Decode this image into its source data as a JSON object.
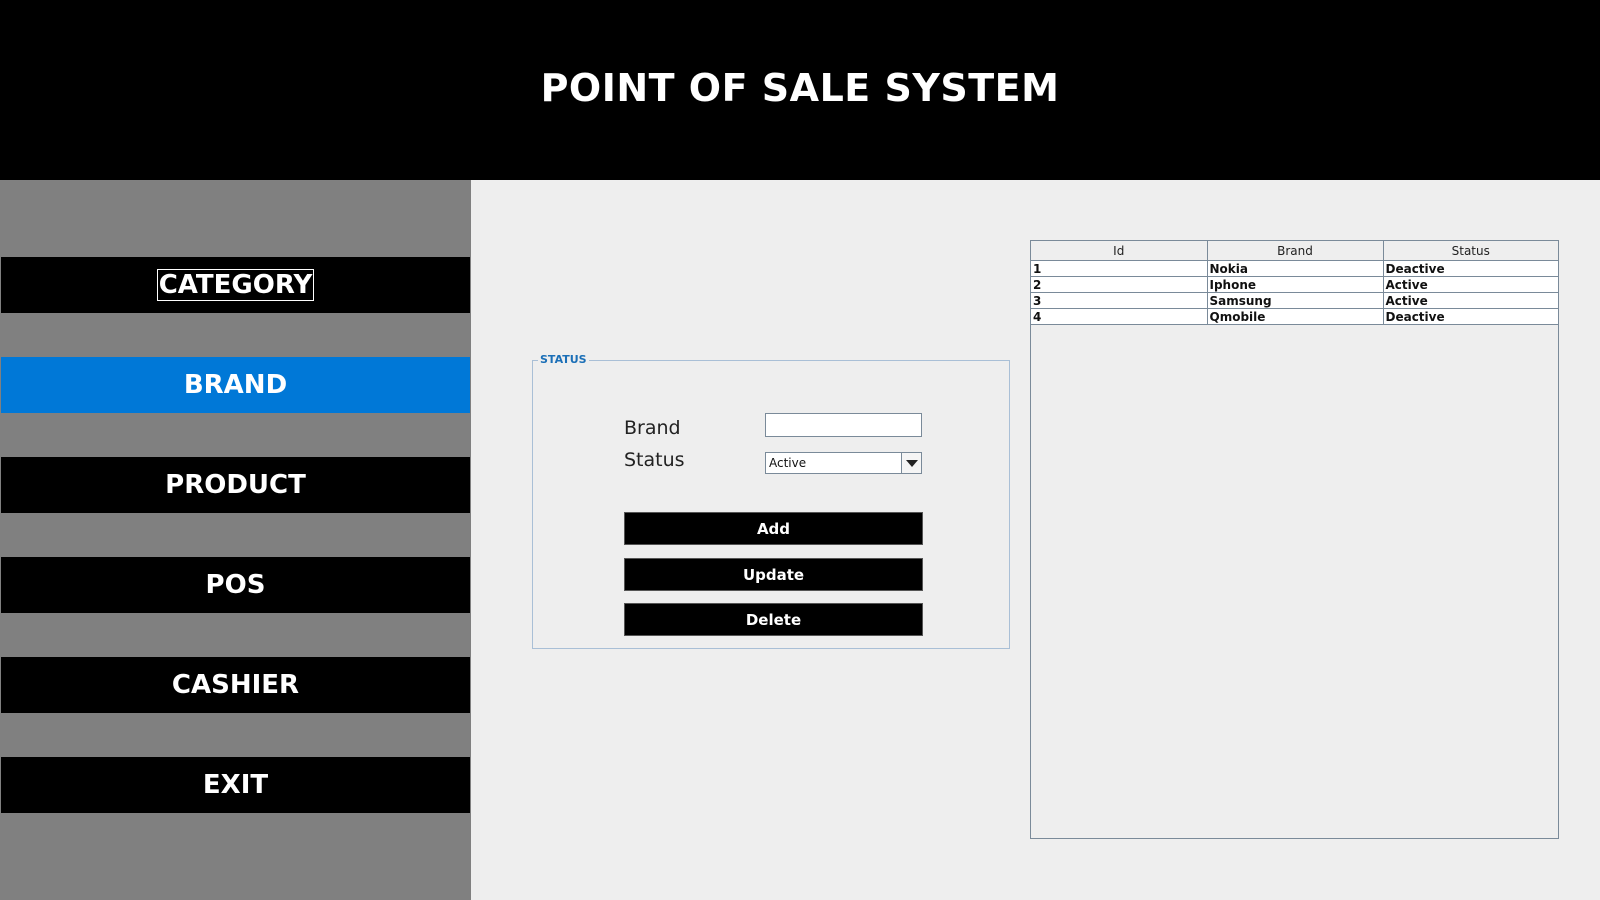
{
  "header": {
    "title": "POINT OF SALE SYSTEM"
  },
  "sidebar": {
    "items": [
      {
        "label": "CATEGORY",
        "active": false,
        "focused": true
      },
      {
        "label": "BRAND",
        "active": true,
        "focused": false
      },
      {
        "label": "PRODUCT",
        "active": false,
        "focused": false
      },
      {
        "label": "POS",
        "active": false,
        "focused": false
      },
      {
        "label": "CASHIER",
        "active": false,
        "focused": false
      },
      {
        "label": "EXIT",
        "active": false,
        "focused": false
      }
    ]
  },
  "form": {
    "group_title": "STATUS",
    "brand_label": "Brand",
    "brand_value": "",
    "status_label": "Status",
    "status_value": "Active",
    "buttons": {
      "add": "Add",
      "update": "Update",
      "delete": "Delete"
    }
  },
  "table": {
    "columns": [
      "Id",
      "Brand",
      "Status"
    ],
    "rows": [
      [
        "1",
        "Nokia",
        "Deactive"
      ],
      [
        "2",
        "Iphone",
        "Active"
      ],
      [
        "3",
        "Samsung",
        "Active"
      ],
      [
        "4",
        "Qmobile",
        "Deactive"
      ]
    ]
  },
  "colors": {
    "header_bg": "#000000",
    "sidebar_bg": "#808080",
    "active_item": "#0078d7",
    "content_bg": "#eeeeee",
    "group_title": "#1b6fb7"
  }
}
